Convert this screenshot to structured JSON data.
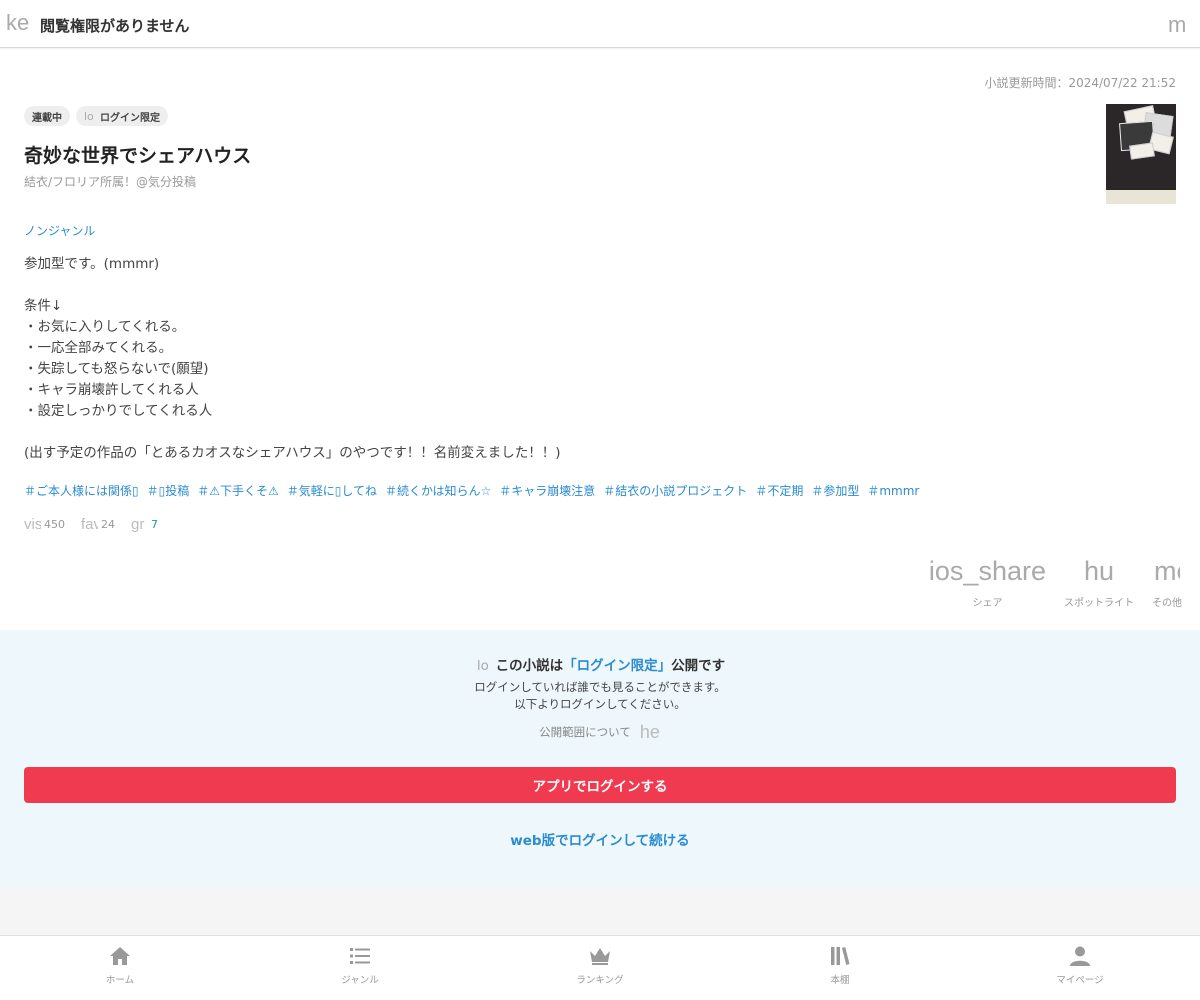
{
  "header": {
    "back_icon_text": "ke",
    "title": "閲覧権限がありません",
    "menu_icon_text": "m"
  },
  "novel": {
    "updated": "小説更新時間：2024/07/22 21:52",
    "badges": [
      {
        "label": "連載中"
      },
      {
        "icon_text": "lo",
        "label": "ログイン限定"
      }
    ],
    "title": "奇妙な世界でシェアハウス",
    "author": "結衣/フロリア所属！@気分投稿",
    "genre": "ノンジャンル",
    "description": "参加型です。(mmmr)\n\n条件↓\n・お気に入りしてくれる。\n・一応全部みてくれる。\n・失踪しても怒らないで(願望)\n・キャラ崩壊許してくれる人\n・設定しっかりでしてくれる人\n\n(出す予定の作品の「とあるカオスなシェアハウス」のやつです！！名前変えました！！)",
    "tags": [
      "＃ご本人様には関係▯",
      "＃▯投稿",
      "＃⚠下手くそ⚠",
      "＃気軽に▯してね",
      "＃続くかは知らん☆",
      "＃キャラ崩壊注意",
      "＃結衣の小説プロジェクト",
      "＃不定期",
      "＃参加型",
      "＃mmmr"
    ],
    "stats": {
      "views_icon": "vis",
      "views": "450",
      "favorites_icon": "fav",
      "favorites": "24",
      "good_icon": "gr",
      "good": "7"
    }
  },
  "actions": [
    {
      "icon_text": "ios_share",
      "label": "シェア"
    },
    {
      "icon_text": "hu",
      "label": "スポットライト"
    },
    {
      "icon_text": "me",
      "label": "その他"
    }
  ],
  "login_panel": {
    "lock_icon_text": "lo",
    "head_prefix": "この小説は",
    "head_highlight": "「ログイン限定」",
    "head_suffix": "公開です",
    "line1": "ログインしていれば誰でも見ることができます。",
    "line2": "以下よりログインしてください。",
    "scope_link": "公開範囲について",
    "help_icon_text": "he",
    "app_login": "アプリでログインする",
    "web_login": "web版でログインして続ける"
  },
  "bottom_nav": [
    {
      "icon": "home-icon",
      "label": "ホーム"
    },
    {
      "icon": "list-icon",
      "label": "ジャンル"
    },
    {
      "icon": "crown-icon",
      "label": "ランキング"
    },
    {
      "icon": "bookshelf-icon",
      "label": "本棚"
    },
    {
      "icon": "person-icon",
      "label": "マイページ"
    }
  ],
  "colors": {
    "accent_blue": "#2a8bd1",
    "login_red": "#ef3a4f",
    "panel_bg": "#eef7fc"
  }
}
